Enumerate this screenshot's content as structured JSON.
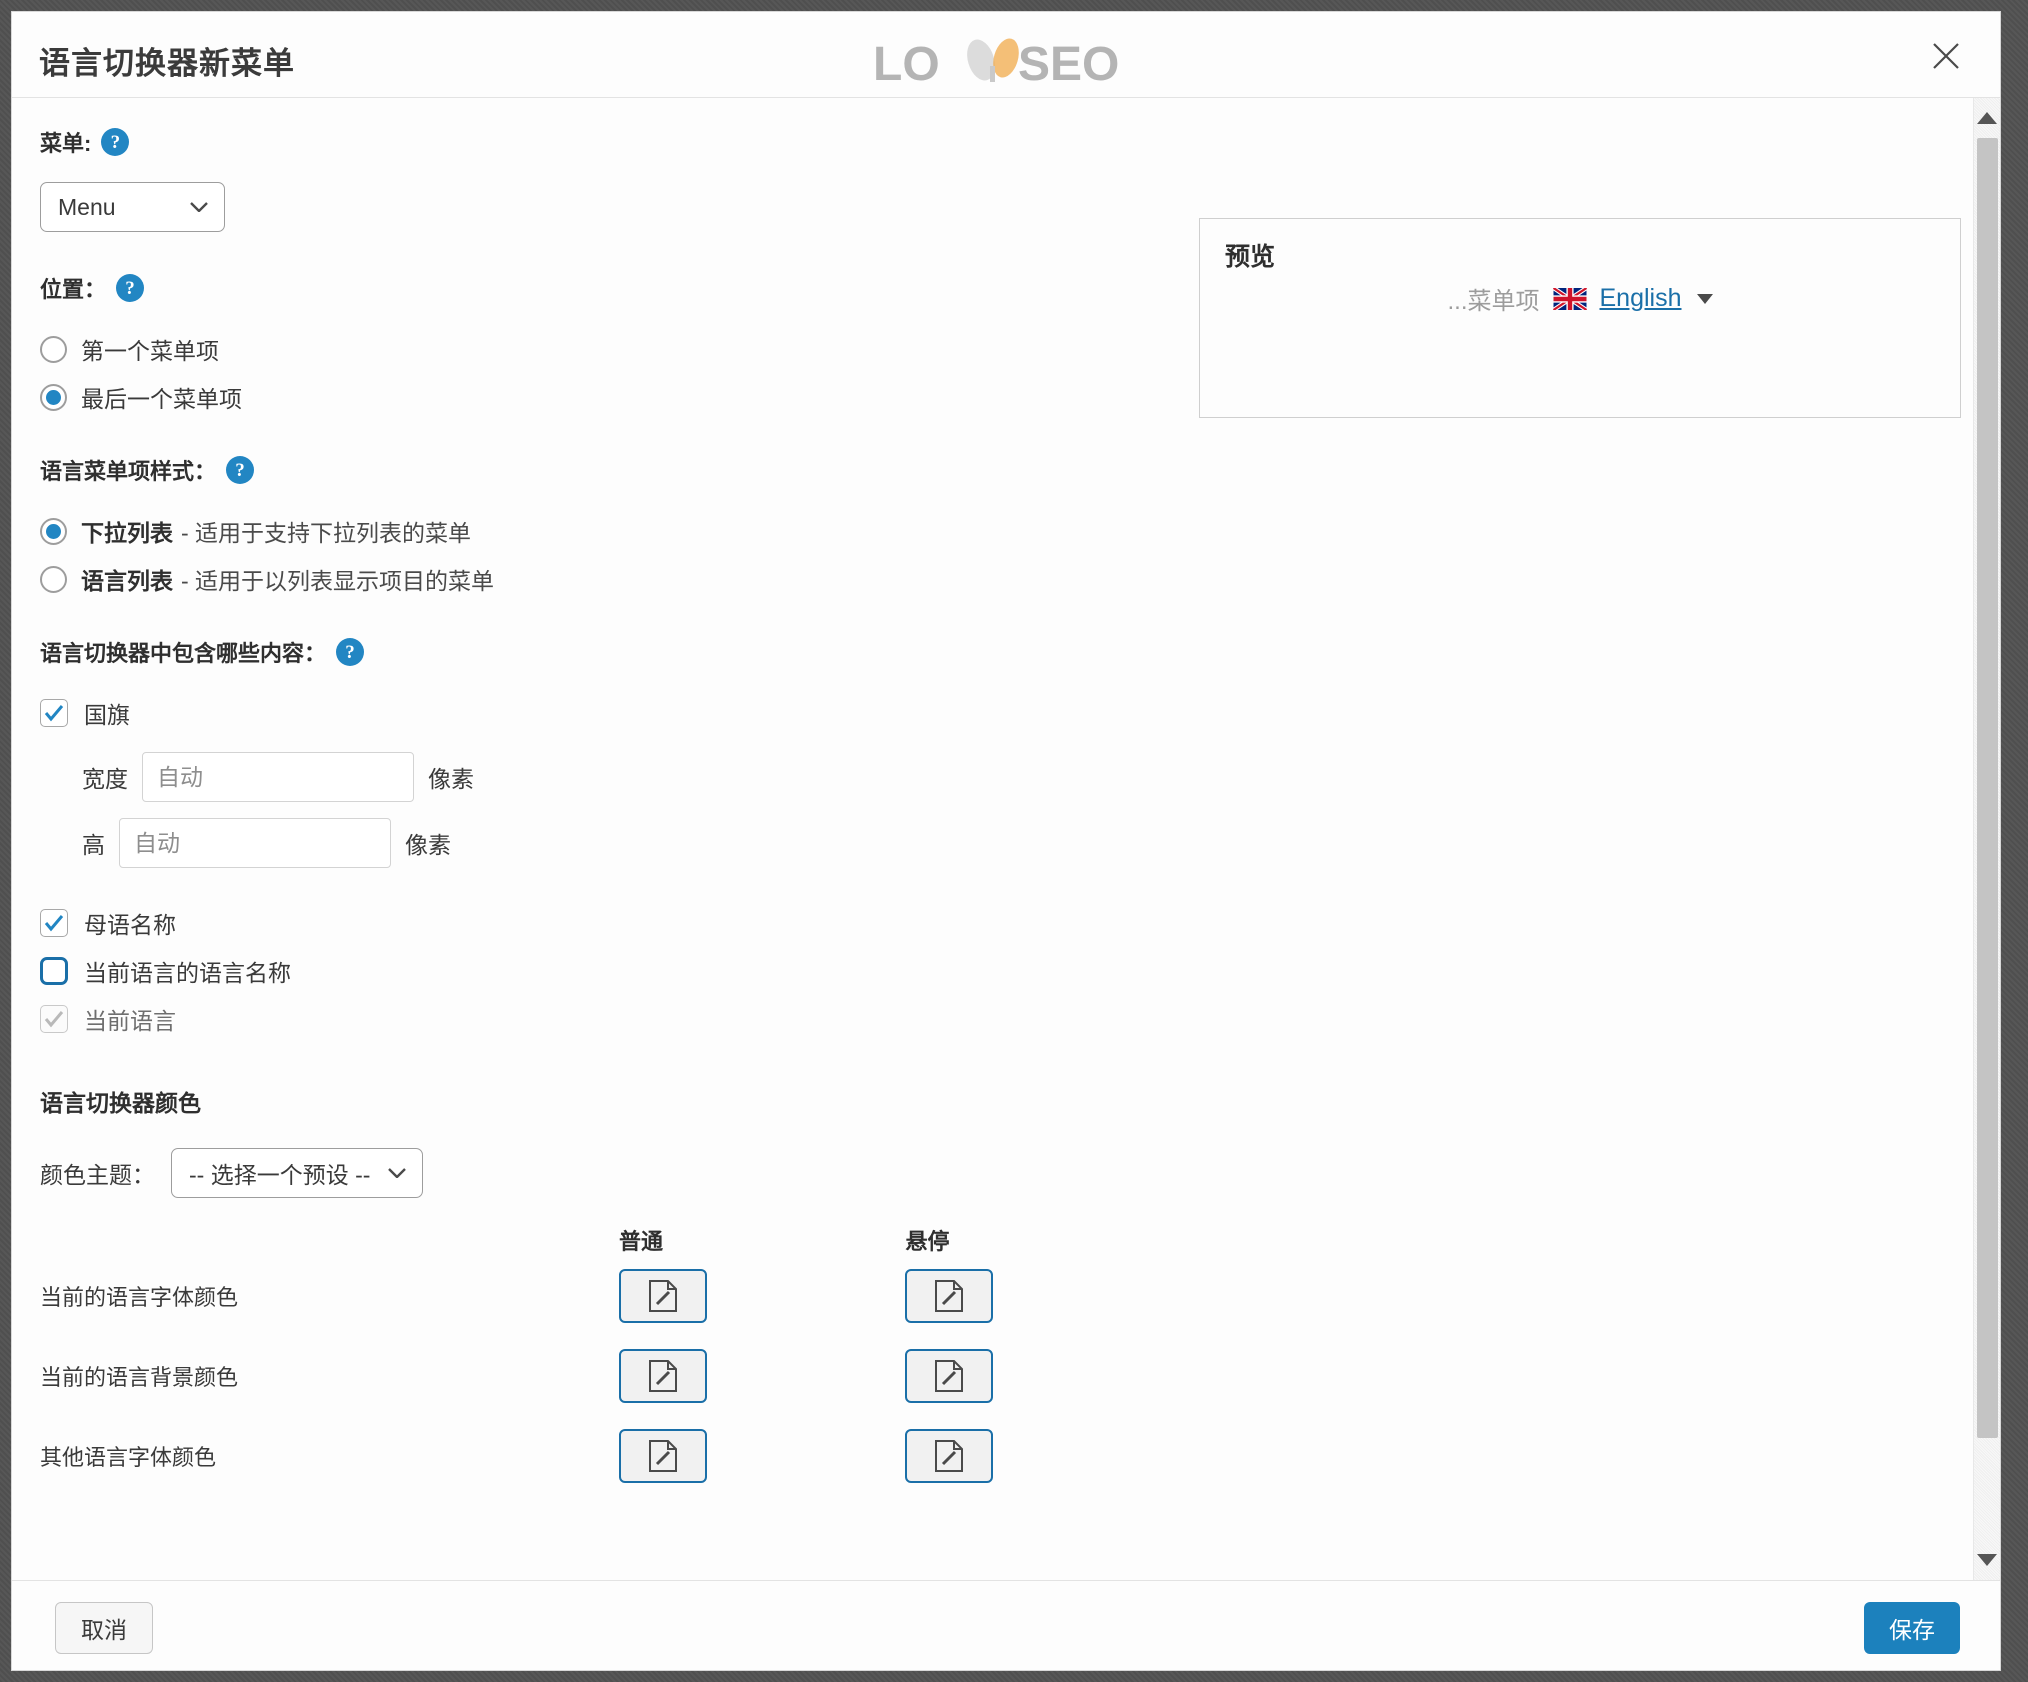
{
  "header": {
    "title": "语言切换器新菜单",
    "logo_text": "LOYSEO",
    "logo_part1": "LO",
    "logo_part2": "SEO",
    "close_label": "×"
  },
  "form": {
    "menu": {
      "label": "菜单:",
      "help": "?",
      "selected": "Menu",
      "options": [
        "Menu"
      ]
    },
    "position": {
      "label": "位置：",
      "help": "?",
      "options": [
        {
          "label": "第一个菜单项",
          "checked": false
        },
        {
          "label": "最后一个菜单项",
          "checked": true
        }
      ]
    },
    "item_style": {
      "label": "语言菜单项样式：",
      "help": "?",
      "options": [
        {
          "name": "下拉列表",
          "desc": "- 适用于支持下拉列表的菜单",
          "checked": true
        },
        {
          "name": "语言列表",
          "desc": "- 适用于以列表显示项目的菜单",
          "checked": false
        }
      ]
    },
    "contents": {
      "label": "语言切换器中包含哪些内容：",
      "help": "?",
      "flag": {
        "label": "国旗",
        "checked": true
      },
      "width": {
        "label": "宽度",
        "placeholder": "自动",
        "value": "",
        "unit": "像素"
      },
      "height": {
        "label": "高",
        "placeholder": "自动",
        "value": "",
        "unit": "像素"
      },
      "checkboxes": [
        {
          "label": "母语名称",
          "checked": true,
          "focused": false,
          "disabled": false
        },
        {
          "label": "当前语言的语言名称",
          "checked": false,
          "focused": true,
          "disabled": false
        },
        {
          "label": "当前语言",
          "checked": true,
          "focused": false,
          "disabled": true
        }
      ]
    },
    "colors": {
      "section_title": "语言切换器颜色",
      "theme_label": "颜色主题：",
      "theme_selected": "-- 选择一个预设 --",
      "theme_options": [
        "-- 选择一个预设 --"
      ],
      "columns": [
        "普通",
        "悬停"
      ],
      "rows": [
        {
          "label": "当前的语言字体颜色"
        },
        {
          "label": "当前的语言背景颜色"
        },
        {
          "label": "其他语言字体颜色"
        }
      ]
    }
  },
  "preview": {
    "title": "预览",
    "menu_item": "...菜单项",
    "language": "English",
    "flag": "uk-flag-icon",
    "caret": "▼"
  },
  "footer": {
    "cancel": "取消",
    "save": "保存"
  },
  "colors": {
    "accent": "#1c81bd",
    "help_icon": "#2286c3",
    "link": "#1a6fa8",
    "swatch_border": "#1a6fa8",
    "text": "#3a3a3a"
  }
}
